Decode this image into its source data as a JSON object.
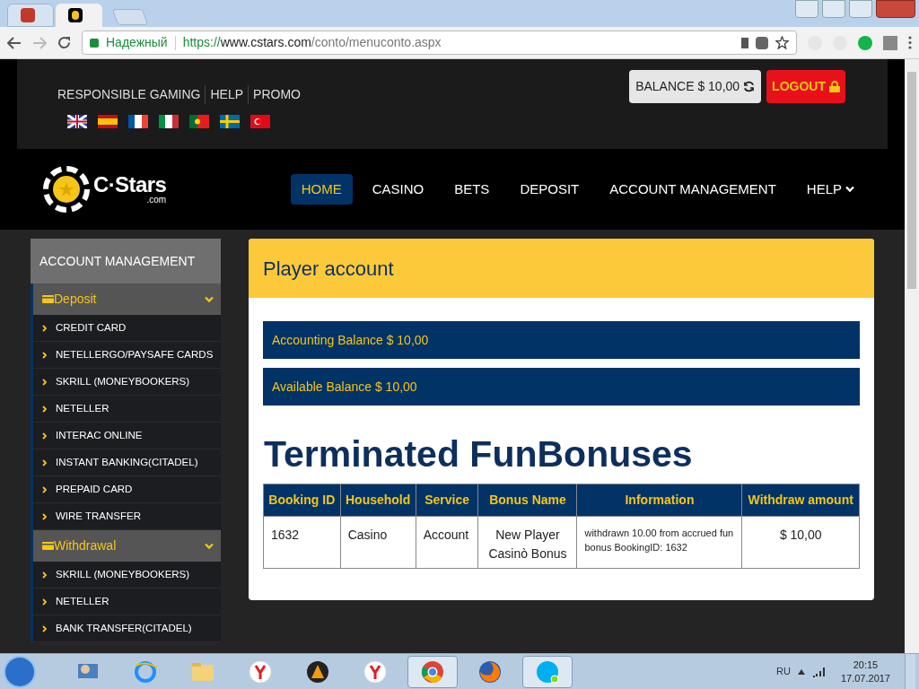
{
  "browser": {
    "tabs": [
      {
        "kind": "crown",
        "selected": false
      },
      {
        "kind": "chip",
        "selected": true
      }
    ],
    "security_label": "Надежный",
    "url_scheme": "https://",
    "url_host": "www.cstars.com",
    "url_path": "/conto/menuconto.aspx"
  },
  "top_links": [
    "RESPONSIBLE GAMING",
    "HELP",
    "PROMO"
  ],
  "flags": [
    {
      "kind": "uk"
    },
    {
      "kind": "es"
    },
    {
      "kind": "fr"
    },
    {
      "kind": "it"
    },
    {
      "kind": "pt"
    },
    {
      "kind": "se"
    },
    {
      "kind": "tr"
    }
  ],
  "balance_button": "BALANCE $ 10,00",
  "logout_button": "LOGOUT",
  "logo": {
    "name": "C·Stars",
    "domain": ".com"
  },
  "nav": [
    {
      "label": "HOME",
      "selected": true,
      "dropdown": false
    },
    {
      "label": "CASINO",
      "selected": false,
      "dropdown": false
    },
    {
      "label": "BETS",
      "selected": false,
      "dropdown": false
    },
    {
      "label": "DEPOSIT",
      "selected": false,
      "dropdown": false
    },
    {
      "label": "ACCOUNT MANAGEMENT",
      "selected": false,
      "dropdown": false
    },
    {
      "label": "HELP",
      "selected": false,
      "dropdown": true
    }
  ],
  "sidebar": {
    "title": "ACCOUNT MANAGEMENT",
    "groups": [
      {
        "label": "Deposit",
        "expanded": true,
        "items": [
          "CREDIT CARD",
          "NETELLERGO/PAYSAFE CARDS",
          "SKRILL (MONEYBOOKERS)",
          "NETELLER",
          "INTERAC ONLINE",
          "INSTANT BANKING(CITADEL)",
          "PREPAID CARD",
          "WIRE TRANSFER"
        ]
      },
      {
        "label": "Withdrawal",
        "expanded": true,
        "items": [
          "SKRILL (MONEYBOOKERS)",
          "NETELLER",
          "BANK TRANSFER(CITADEL)"
        ]
      }
    ]
  },
  "main": {
    "title": "Player account",
    "balances": [
      "Accounting Balance $ 10,00",
      "Available Balance $ 10,00"
    ],
    "section_title": "Terminated FunBonuses",
    "table": {
      "columns": [
        "Booking ID",
        "Household",
        "Service",
        "Bonus Name",
        "Information",
        "Withdraw amount"
      ],
      "rows": [
        [
          "1632",
          "Casino",
          "Account",
          "New Player Casinò Bonus",
          "withdrawn 10.00 from accrued fun bonus BookingID: 1632",
          "$ 10,00"
        ]
      ]
    }
  },
  "taskbar": {
    "apps": [
      {
        "kind": "user",
        "active": false
      },
      {
        "kind": "ie",
        "active": false
      },
      {
        "kind": "folder",
        "active": false
      },
      {
        "kind": "yandex",
        "active": false
      },
      {
        "kind": "aimp",
        "active": false
      },
      {
        "kind": "yandex",
        "active": false
      },
      {
        "kind": "chrome",
        "active": true
      },
      {
        "kind": "firefox",
        "active": false
      },
      {
        "kind": "skype",
        "active": true
      }
    ],
    "language": "RU",
    "time": "20:15",
    "date": "17.07.2017"
  }
}
